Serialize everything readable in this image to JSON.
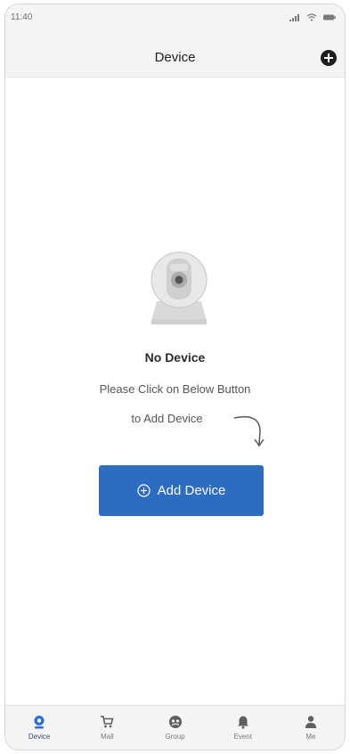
{
  "status_bar": {
    "time": "11:40"
  },
  "nav": {
    "title": "Device",
    "add_icon": "plus-circle-icon"
  },
  "empty_state": {
    "title": "No Device",
    "line1": "Please Click on Below Button",
    "line2": "to Add Device",
    "illustration": "camera-icon"
  },
  "add_button": {
    "label": "Add Device",
    "icon": "plus-circle-outline-icon"
  },
  "tabs": [
    {
      "label": "Device",
      "icon": "camera-icon",
      "active": true
    },
    {
      "label": "Mall",
      "icon": "cart-icon",
      "active": false
    },
    {
      "label": "Group",
      "icon": "group-icon",
      "active": false
    },
    {
      "label": "Event",
      "icon": "bell-icon",
      "active": false
    },
    {
      "label": "Me",
      "icon": "person-icon",
      "active": false
    }
  ],
  "colors": {
    "accent": "#2c6dbf",
    "active_tab": "#2b6fd0",
    "inactive_tab": "#8a8a8a",
    "bar_background": "#f4f4f4"
  }
}
